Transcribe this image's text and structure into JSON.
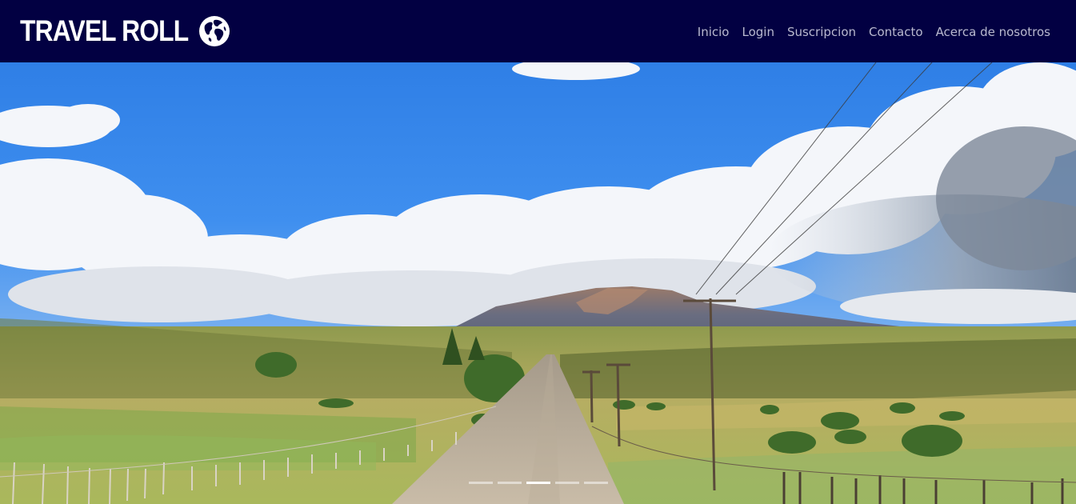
{
  "brand": {
    "name": "TRAVEL ROLL",
    "icon": "globe-icon"
  },
  "nav": {
    "items": [
      {
        "label": "Inicio"
      },
      {
        "label": "Login"
      },
      {
        "label": "Suscripcion"
      },
      {
        "label": "Contacto"
      },
      {
        "label": "Acerca de nosotros"
      }
    ]
  },
  "carousel": {
    "slide_count": 5,
    "active_index": 2
  },
  "colors": {
    "navbar_bg": "#020042",
    "nav_link": "#b9b9cf",
    "brand_text": "#ffffff"
  }
}
